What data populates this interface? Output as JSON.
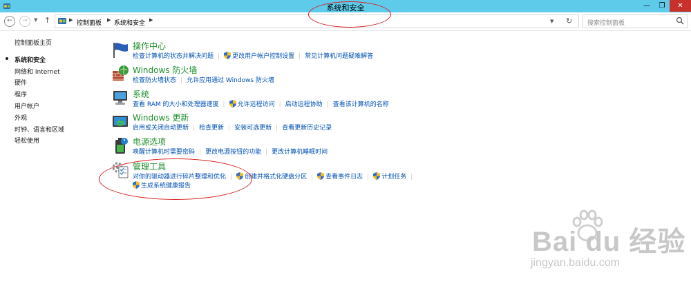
{
  "window": {
    "title": "系统和安全",
    "minimize": "—",
    "maximize": "❐",
    "close": "✕"
  },
  "nav": {
    "back": "←",
    "forward": "→",
    "up": "↑",
    "breadcrumbs": [
      "控制面板",
      "系统和安全"
    ],
    "search_placeholder": "搜索控制面板"
  },
  "sidebar": {
    "items": [
      {
        "label": "控制面板主页"
      },
      {
        "label": "系统和安全",
        "selected": true
      },
      {
        "label": "网络和 Internet"
      },
      {
        "label": "硬件"
      },
      {
        "label": "程序"
      },
      {
        "label": "用户帐户"
      },
      {
        "label": "外观"
      },
      {
        "label": "时钟、语言和区域"
      },
      {
        "label": "轻松使用"
      }
    ]
  },
  "categories": [
    {
      "title": "操作中心",
      "icon": "action-center-flag-icon",
      "links": [
        "检查计算机的状态并解决问题",
        "更改用户帐户控制设置",
        "常见计算机问题疑难解答"
      ]
    },
    {
      "title": "Windows 防火墙",
      "icon": "firewall-icon",
      "links": [
        "检查防火墙状态",
        "允许应用通过 Windows 防火墙"
      ]
    },
    {
      "title": "系统",
      "icon": "system-computer-icon",
      "links": [
        "查看 RAM 的大小和处理器速度",
        "允许远程访问",
        "启动远程协助",
        "查看该计算机的名称"
      ]
    },
    {
      "title": "Windows 更新",
      "icon": "windows-update-icon",
      "links": [
        "启用或关闭自动更新",
        "检查更新",
        "安装可选更新",
        "查看更新历史记录"
      ]
    },
    {
      "title": "电源选项",
      "icon": "power-options-icon",
      "links": [
        "唤醒计算机时需要密码",
        "更改电源按钮的功能",
        "更改计算机睡眠时间"
      ]
    },
    {
      "title": "管理工具",
      "icon": "admin-tools-icon",
      "links": [
        "对你的驱动器进行碎片整理和优化",
        "创建并格式化硬盘分区",
        "查看事件日志",
        "计划任务"
      ],
      "links2": [
        "生成系统健康报告"
      ]
    }
  ],
  "watermark": {
    "brand": "Bai du 经验",
    "url": "jingyan.baidu.com"
  },
  "colors": {
    "titlebar": "#5fcbeb",
    "close": "#c7302b",
    "category_title": "#1e8f2b",
    "link": "#0050b4",
    "annotation": "#d81e1e"
  }
}
